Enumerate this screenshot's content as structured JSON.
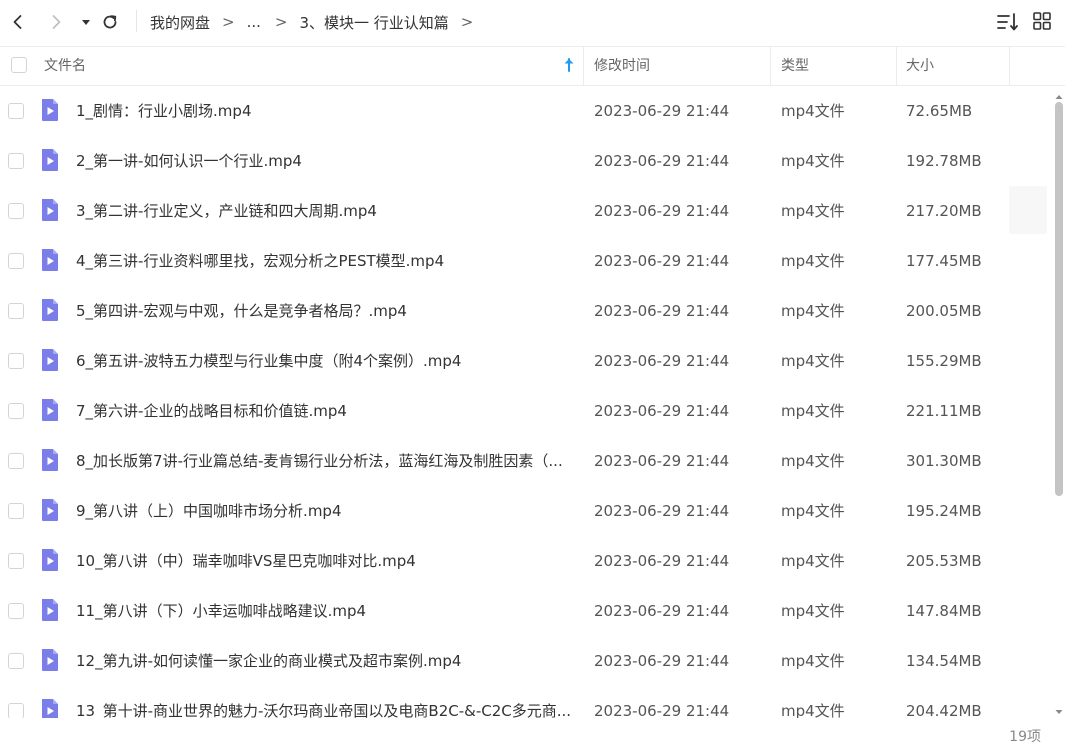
{
  "breadcrumb": {
    "root": "我的网盘",
    "ellipsis": "...",
    "current": "3、模块一 行业认知篇",
    "separator": ">"
  },
  "icons": {
    "back": "chevron-left-icon",
    "forward": "chevron-right-icon",
    "history": "caret-down-icon",
    "refresh": "refresh-icon",
    "sort": "sort-list-icon",
    "grid": "grid-view-icon",
    "file": "video-file-icon",
    "sort_asc": "arrow-up-icon"
  },
  "colors": {
    "accent": "#1e9bf0",
    "file_icon": "#7b7ee8"
  },
  "table": {
    "headers": {
      "name": "文件名",
      "modified": "修改时间",
      "type": "类型",
      "size": "大小"
    },
    "rows": [
      {
        "name": "1_剧情：行业小剧场.mp4",
        "modified": "2023-06-29 21:44",
        "type": "mp4文件",
        "size": "72.65MB"
      },
      {
        "name": "2_第一讲-如何认识一个行业.mp4",
        "modified": "2023-06-29 21:44",
        "type": "mp4文件",
        "size": "192.78MB"
      },
      {
        "name": "3_第二讲-行业定义，产业链和四大周期.mp4",
        "modified": "2023-06-29 21:44",
        "type": "mp4文件",
        "size": "217.20MB"
      },
      {
        "name": "4_第三讲-行业资料哪里找，宏观分析之PEST模型.mp4",
        "modified": "2023-06-29 21:44",
        "type": "mp4文件",
        "size": "177.45MB"
      },
      {
        "name": "5_第四讲-宏观与中观，什么是竞争者格局？.mp4",
        "modified": "2023-06-29 21:44",
        "type": "mp4文件",
        "size": "200.05MB"
      },
      {
        "name": "6_第五讲-波特五力模型与行业集中度（附4个案例）.mp4",
        "modified": "2023-06-29 21:44",
        "type": "mp4文件",
        "size": "155.29MB"
      },
      {
        "name": "7_第六讲-企业的战略目标和价值链.mp4",
        "modified": "2023-06-29 21:44",
        "type": "mp4文件",
        "size": "221.11MB"
      },
      {
        "name": "8_加长版第7讲-行业篇总结-麦肯锡行业分析法，蓝海红海及制胜因素（...",
        "modified": "2023-06-29 21:44",
        "type": "mp4文件",
        "size": "301.30MB"
      },
      {
        "name": "9_第八讲（上）中国咖啡市场分析.mp4",
        "modified": "2023-06-29 21:44",
        "type": "mp4文件",
        "size": "195.24MB"
      },
      {
        "name": "10_第八讲（中）瑞幸咖啡VS星巴克咖啡对比.mp4",
        "modified": "2023-06-29 21:44",
        "type": "mp4文件",
        "size": "205.53MB"
      },
      {
        "name": "11_第八讲（下）小幸运咖啡战略建议.mp4",
        "modified": "2023-06-29 21:44",
        "type": "mp4文件",
        "size": "147.84MB"
      },
      {
        "name": "12_第九讲-如何读懂一家企业的商业模式及超市案例.mp4",
        "modified": "2023-06-29 21:44",
        "type": "mp4文件",
        "size": "134.54MB"
      },
      {
        "name": "13_第十讲-商业世界的魅力-沃尔玛商业帝国以及电商B2C-&-C2C多元商...",
        "modified": "2023-06-29 21:44",
        "type": "mp4文件",
        "size": "204.42MB"
      }
    ]
  },
  "footer": {
    "count": "19项"
  }
}
